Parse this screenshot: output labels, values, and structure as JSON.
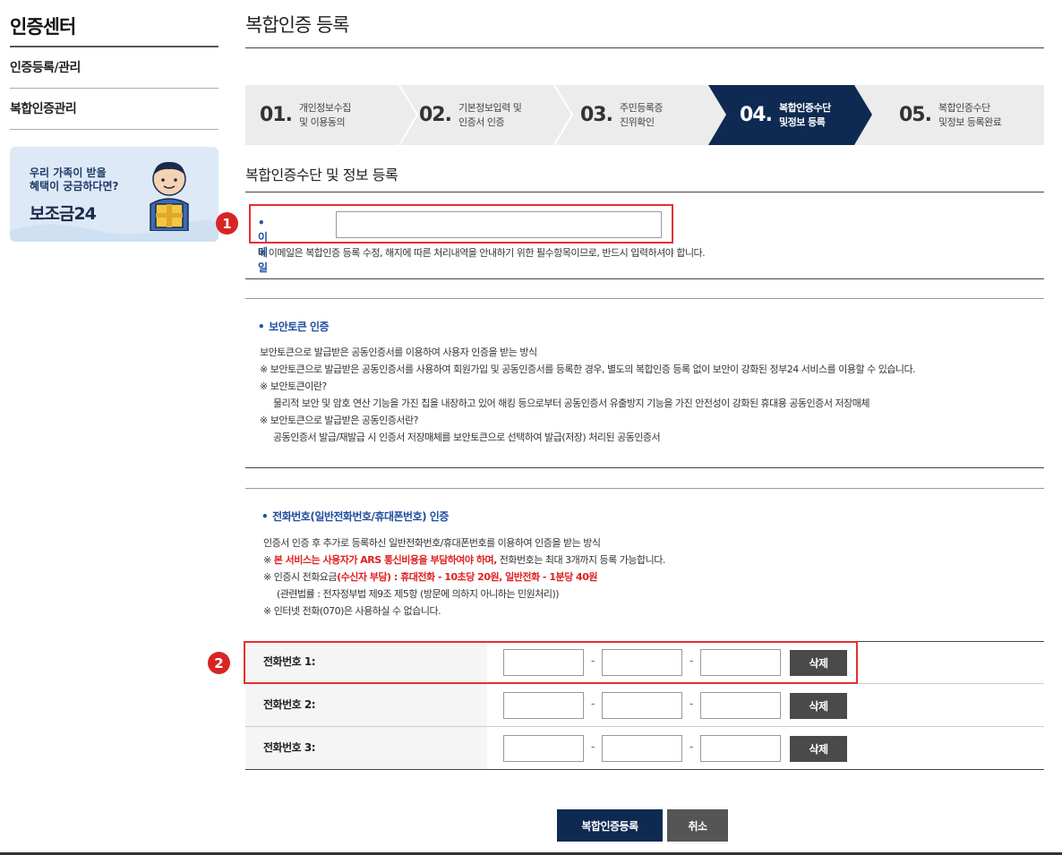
{
  "sidebar": {
    "title": "인증센터",
    "items": [
      {
        "label": "인증등록/관리"
      },
      {
        "label": "복합인증관리"
      }
    ],
    "banner": {
      "line1": "우리 가족이 받을",
      "line2": "혜택이 궁금하다면?",
      "name": "보조금24"
    }
  },
  "main": {
    "page_title": "복합인증 등록",
    "steps": [
      {
        "num": "01.",
        "line1": "개인정보수집",
        "line2": "및 이용동의",
        "active": false
      },
      {
        "num": "02.",
        "line1": "기본정보입력 및",
        "line2": "인증서 인증",
        "active": false
      },
      {
        "num": "03.",
        "line1": "주민등록증",
        "line2": "진위확인",
        "active": false
      },
      {
        "num": "04.",
        "line1": "복합인증수단",
        "line2": "및정보 등록",
        "active": true
      },
      {
        "num": "05.",
        "line1": "복합인증수단",
        "line2": "및정보 등록완료",
        "active": false
      }
    ],
    "section_title": "복합인증수단 및 정보 등록",
    "email": {
      "label": "이메일",
      "value": "",
      "note": "※ 이메일은 복합인증 등록 수정, 해지에 따른 처리내역을 안내하기 위한 필수항목이므로, 반드시 입력하셔야 합니다."
    },
    "security_token": {
      "label": "보안토큰 인증",
      "lines": [
        "보안토큰으로 발급받은 공동인증서를 이용하여 사용자 인증을 받는 방식",
        "※ 보안토큰으로 발급받은 공동인증서를 사용하여 회원가입 및 공동인증서를 등록한 경우, 별도의 복합인증 등록 없이 보안이 강화된 정부24 서비스를 이용할 수 있습니다.",
        "※ 보안토큰이란?",
        "물리적 보안 및 암호 연산 기능을 가진 칩을 내장하고 있어 해킹 등으로부터 공동인증서 유출방지 기능을 가진 안전성이 강화된 휴대용 공동인증서 저장매체",
        "※ 보안토큰으로 발급받은 공동인증서란?",
        "공동인증서 발급/재발급 시 인증서 저장매체를 보안토큰으로 선택하여 발급(저장) 처리된 공동인증서"
      ]
    },
    "phone": {
      "label": "전화번호(일반전화번호/휴대폰번호) 인증",
      "line1": "인증서 인증 후 추가로 등록하신 일반전화번호/휴대폰번호를 이용하여 인증을 받는 방식",
      "line2_prefix": "※ ",
      "line2_red": "본 서비스는 사용자가 ARS 통신비용을 부담하여야 하며,",
      "line2_rest": " 전화번호는 최대 3개까지 등록 가능합니다.",
      "line3_prefix": "※ 인증시 전화요금",
      "line3_red": "(수신자 부담) : 휴대전화 - 10초당 20원, 일반전화 - 1분당 40원",
      "line4": "(관련법률 : 전자정부법 제9조 제5항 (방문에 의하지 아니하는 민원처리))",
      "line5": "※ 인터넷 전화(070)은 사용하실 수 없습니다.",
      "rows": [
        {
          "label": "전화번호 1:",
          "delete": "삭제"
        },
        {
          "label": "전화번호 2:",
          "delete": "삭제"
        },
        {
          "label": "전화번호 3:",
          "delete": "삭제"
        }
      ]
    },
    "actions": {
      "submit": "복합인증등록",
      "cancel": "취소"
    }
  },
  "annotations": {
    "one": "1",
    "two": "2"
  },
  "colors": {
    "active_step": "#0e2a52",
    "label_blue": "#1f4ea0",
    "highlight_red": "#e53030"
  }
}
